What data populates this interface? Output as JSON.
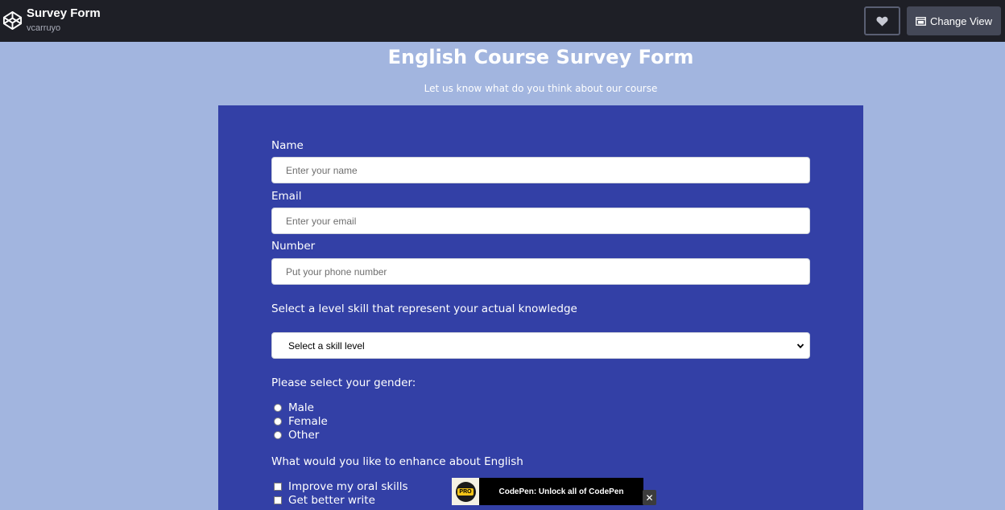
{
  "topbar": {
    "title": "Survey Form",
    "author": "vcarruyo",
    "change_view_label": "Change View"
  },
  "page": {
    "title": "English Course Survey Form",
    "description": "Let us know what do you think about our course"
  },
  "form": {
    "name_label": "Name",
    "name_placeholder": "Enter your name",
    "email_label": "Email",
    "email_placeholder": "Enter your email",
    "number_label": "Number",
    "number_placeholder": "Put your phone number",
    "skill_label": "Select a level skill that represent your actual knowledge",
    "skill_selected": "Select a skill level",
    "gender_label": "Please select your gender:",
    "gender_options": [
      "Male",
      "Female",
      "Other"
    ],
    "enhance_label": "What would you like to enhance about English",
    "enhance_options": [
      "Improve my oral skills",
      "Get better write"
    ]
  },
  "promo": {
    "badge": "PRO",
    "text": "CodePen: Unlock all of CodePen",
    "close": "✕"
  },
  "colors": {
    "topbar_bg": "#1e1f26",
    "page_bg": "#a2b5df",
    "form_bg": "#3340a6"
  }
}
